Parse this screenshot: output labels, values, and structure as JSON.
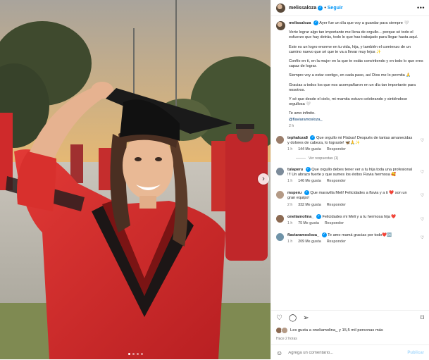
{
  "post": {
    "username": "melissaloza",
    "follow_label": "Seguir",
    "more_icon": "more-options-icon",
    "caption": [
      "Ayer fue un día que voy a guardar para siempre 🤍",
      "Verte lograr algo tan importante me llena de orgullo... porque sé todo el esfuerzo que hay detrás, todo lo que has trabajado para llegar hasta aquí.",
      "Este es un logro enorme en tu vida, hija, y también el comienzo de un camino nuevo que sé que te va a llevar muy lejos ✨",
      "Confío en ti, en la mujer en la que te estás convirtiendo y en todo lo que eres capaz de lograr.",
      "Siempre voy a estar contigo, en cada paso, así Dios me lo permita 🙏",
      "Gracias a todos los que nos acompañaron en un día tan importante para nosotros.",
      "Y sé que desde el cielo, mi mamita estuvo celebrando y sintiéndose orgullosa 🤍",
      "Te amo infinito."
    ],
    "mention": "@flaviaramosloza_",
    "time": "2 h"
  },
  "comments": [
    {
      "user": "tephaloza8",
      "text": "Que orgullo mi Flabus! Después de tantas amanecidas y dolores de cabeza, lo lograste! 🦋🙏✨",
      "time": "1 h",
      "likes": "144 Me gusta",
      "reply": "Responder",
      "replies": "Ver respuestas (1)",
      "color": "#9a7d6a"
    },
    {
      "user": "tulaperu",
      "text": "Que orgullo debes tener ver a tu hija toda una profesional !!! Un abrazo fuerte y que sumes los éxitos Flavia hermosa 🥰",
      "time": "1 h",
      "likes": "146 Me gusta",
      "reply": "Responder",
      "color": "#7c8b9a"
    },
    {
      "user": "msperu",
      "text": "Que maravilla Meli! Felicidades a flavia y a ti ❤️ son un gran equipo!",
      "time": "2 h",
      "likes": "332 Me gusta",
      "reply": "Responder",
      "color": "#b49a86"
    },
    {
      "user": "oneliamolina_",
      "text": "Felicidades mi Meli y a tu hermosa hija ❤️",
      "time": "1 h",
      "likes": "75 Me gusta",
      "reply": "Responder",
      "color": "#8c6a52"
    },
    {
      "user": "flaviaramosloza_",
      "text": "Te amo mamá gracias por todo❤️🆗",
      "time": "1 h",
      "likes": "209 Me gusta",
      "reply": "Responder",
      "color": "#6f93a8"
    }
  ],
  "actions": {
    "likes_text": "Les gusta a oneliamolina_ y 15,5 mil personas más",
    "when": "Hace 2 horas"
  },
  "add_comment": {
    "placeholder": "Agrega un comentario...",
    "post_label": "Publicar"
  },
  "colors": {
    "accent": "#0095f6",
    "gown_red": "#d62b2b",
    "sky": "#e8b870"
  }
}
